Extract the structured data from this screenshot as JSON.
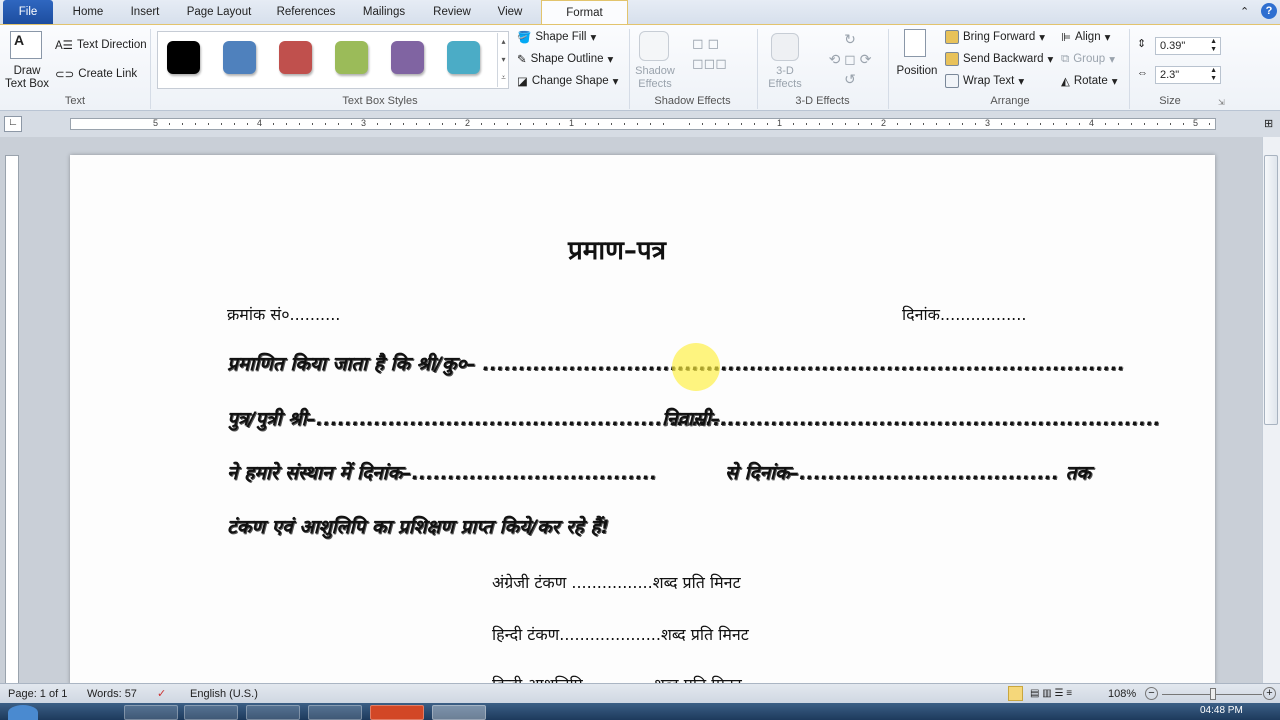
{
  "tabs": [
    "File",
    "Home",
    "Insert",
    "Page Layout",
    "References",
    "Mailings",
    "Review",
    "View",
    "Format"
  ],
  "active_tab": "Format",
  "ribbon": {
    "text_group": {
      "draw_text_box": "Draw Text Box",
      "text_direction": "Text Direction",
      "create_link": "Create Link",
      "label": "Text"
    },
    "text_box_styles": {
      "label": "Text Box Styles",
      "swatches": [
        "#000000",
        "#4f81bd",
        "#c0504d",
        "#9bbb59",
        "#8064a2",
        "#4bacc6"
      ],
      "shape_fill": "Shape Fill",
      "shape_outline": "Shape Outline",
      "change_shape": "Change Shape"
    },
    "shadow": {
      "button": "Shadow Effects",
      "label": "Shadow Effects"
    },
    "three_d": {
      "button": "3-D Effects",
      "label": "3-D Effects"
    },
    "arrange": {
      "position": "Position",
      "bring_forward": "Bring Forward",
      "send_backward": "Send Backward",
      "wrap_text": "Wrap Text",
      "align": "Align",
      "group": "Group",
      "rotate": "Rotate",
      "label": "Arrange"
    },
    "size": {
      "height": "0.39\"",
      "width": "2.3\"",
      "label": "Size"
    }
  },
  "ruler": {
    "labels": [
      "5",
      "4",
      "3",
      "2",
      "1",
      "",
      "1",
      "2",
      "3",
      "4",
      "5"
    ]
  },
  "document": {
    "title": "प्रमाण–पत्र",
    "serial": "क्रमांक सं०..........",
    "date": "दिनांक.................",
    "line1": "प्रमाणित किया जाता है कि श्री/कु०– .........................................................................................",
    "line2a": "पुत्र/पुत्री श्री–...........................................................",
    "line2b": "निवासी–.............................................................",
    "line3a": "ने हमारे संस्थान में दिनांक–..................................",
    "line3b": "से दिनांक–.................................... तक",
    "line4": "टंकण एवं आशुलिपि का प्रशिक्षण प्राप्त किये/कर रहे हैं!",
    "item1": "अंग्रेजी टंकण ................शब्द प्रति मिनट",
    "item2": "हिन्दी टंकण....................शब्द प्रति मिनट",
    "item3": "हिन्दी आशुलिपि..............शब्द प्रति मिनट"
  },
  "status": {
    "page": "Page: 1 of 1",
    "words": "Words: 57",
    "language": "English (U.S.)",
    "zoom": "108%",
    "zoom_level": 108
  },
  "taskbar": {
    "clock": "04:48 PM"
  }
}
